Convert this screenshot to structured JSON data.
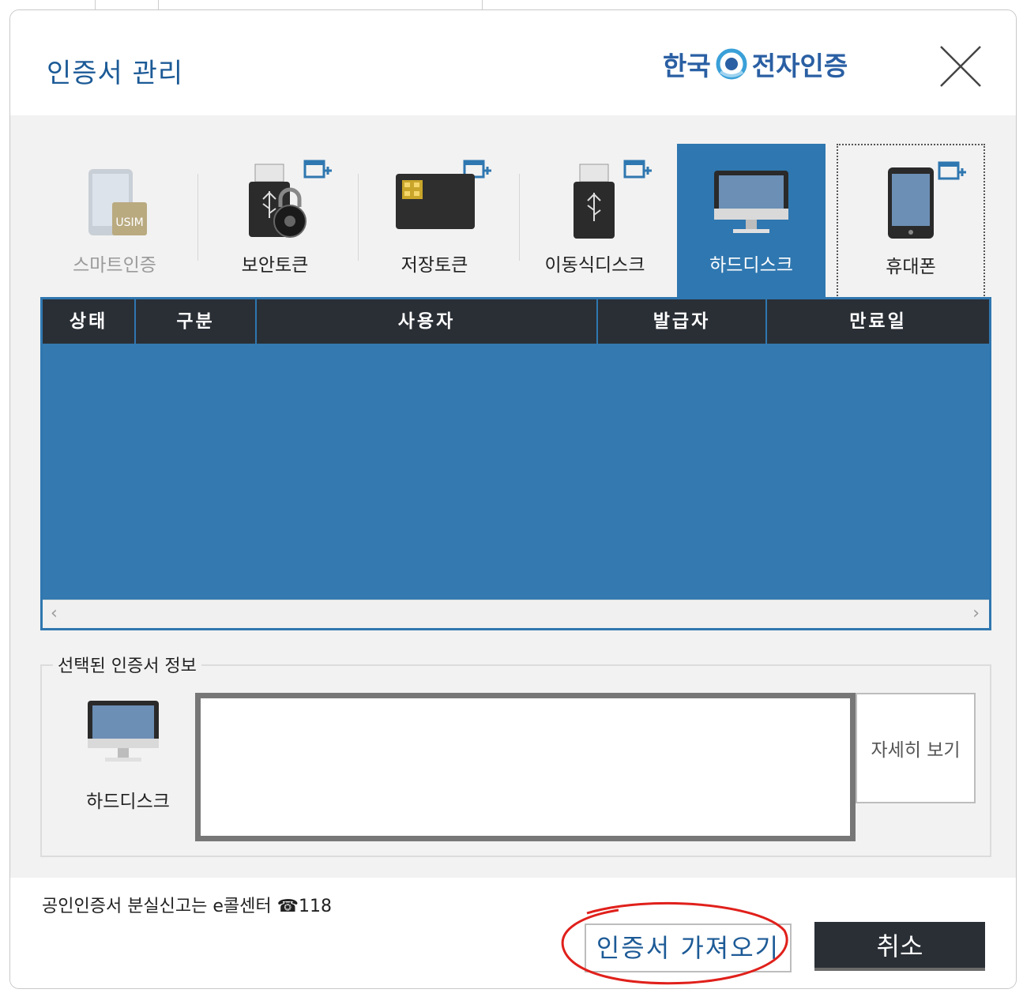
{
  "dialog": {
    "title": "인증서 관리",
    "brand": {
      "left": "한국",
      "right": "전자인증"
    }
  },
  "tabs": [
    {
      "label": "스마트인증",
      "icon": "usim-phone-icon",
      "state": "disabled"
    },
    {
      "label": "보안토큰",
      "icon": "usb-lock-icon",
      "state": "normal"
    },
    {
      "label": "저장토큰",
      "icon": "smartcard-chip-icon",
      "state": "normal"
    },
    {
      "label": "이동식디스크",
      "icon": "usb-drive-icon",
      "state": "normal"
    },
    {
      "label": "하드디스크",
      "icon": "monitor-icon",
      "state": "active"
    },
    {
      "label": "휴대폰",
      "icon": "mobile-phone-icon",
      "state": "focused"
    }
  ],
  "table": {
    "columns": [
      "상태",
      "구분",
      "사용자",
      "발급자",
      "만료일"
    ],
    "rows": []
  },
  "info": {
    "legend": "선택된 인증서 정보",
    "device_label": "하드디스크",
    "detail_button": "자세히 보기"
  },
  "footer": {
    "notice": "공인인증서 분실신고는 e콜센터 ☎118",
    "import_button": "인증서 가져오기",
    "cancel_button": "취소"
  },
  "colors": {
    "accent": "#2f77b0",
    "header_dark": "#2a2f36",
    "title_blue": "#1c5a96",
    "annotation": "#e0201b"
  }
}
